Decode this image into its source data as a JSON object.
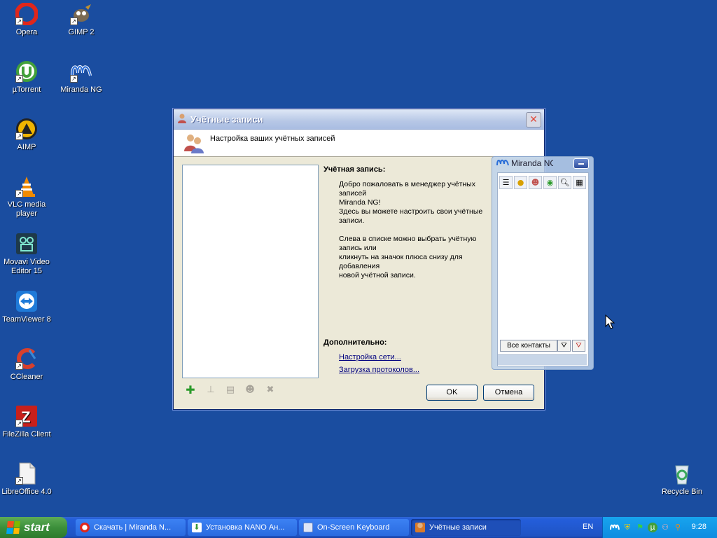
{
  "desktop_icons": [
    {
      "label": "Opera",
      "icon": "opera-icon",
      "color": "#e0261b"
    },
    {
      "label": "GIMP 2",
      "icon": "gimp-icon",
      "color": "#7a6a52"
    },
    {
      "label": "µTorrent",
      "icon": "utorrent-icon",
      "color": "#42a03a"
    },
    {
      "label": "Miranda NG",
      "icon": "miranda-icon",
      "color": "#2a6ed8"
    },
    {
      "label": "AIMP",
      "icon": "aimp-icon",
      "color": "#f0b400"
    },
    {
      "label": "VLC media player",
      "icon": "vlc-icon",
      "color": "#f08a00"
    },
    {
      "label": "Movavi Video Editor 15",
      "icon": "movavi-icon",
      "color": "#1e3a4a"
    },
    {
      "label": "TeamViewer 8",
      "icon": "teamviewer-icon",
      "color": "#1f7ad8"
    },
    {
      "label": "CCleaner",
      "icon": "ccleaner-icon",
      "color": "#d8402c"
    },
    {
      "label": "FileZilla Client",
      "icon": "filezilla-icon",
      "color": "#c7201c"
    },
    {
      "label": "LibreOffice 4.0",
      "icon": "libreoffice-icon",
      "color": "#e8e8e8"
    },
    {
      "label": "Recycle Bin",
      "icon": "recycle-bin-icon",
      "color": "#3aa85c"
    }
  ],
  "dialog": {
    "title": "Учётные записи",
    "header": "Настройка ваших учётных записей",
    "account_label": "Учётная запись:",
    "welcome_text": "Добро пожаловать в менеджер учётных записей\nMiranda NG!\nЗдесь вы можете настроить свои учётные записи.\n\nСлева в списке можно выбрать учётную запись или\nкликнуть на значок плюса снизу для добавления\nновой учётной записи.",
    "extra_label": "Дополнительно:",
    "link_network": "Настройка сети...",
    "link_protocols": "Загрузка протоколов...",
    "ok": "OK",
    "cancel": "Отмена"
  },
  "miranda": {
    "title": "Miranda NG",
    "all_contacts": "Все контакты"
  },
  "taskbar": {
    "start": "start",
    "tasks": [
      {
        "label": "Скачать | Miranda N...",
        "icon": "opera-icon",
        "color": "#e0261b",
        "active": false
      },
      {
        "label": "Установка NANO Ан...",
        "icon": "download-icon",
        "color": "#3a9a3a",
        "active": false
      },
      {
        "label": "On-Screen Keyboard",
        "icon": "keyboard-icon",
        "color": "#6a88c8",
        "active": false
      },
      {
        "label": "Учётные записи",
        "icon": "accounts-icon",
        "color": "#d87a2a",
        "active": true
      }
    ],
    "language": "EN",
    "clock": "9:28"
  },
  "colors": {
    "desktop": "#1a4da0",
    "taskbar": "#245edb",
    "start_green": "#3c8f3b",
    "tray": "#0f8ce0"
  }
}
